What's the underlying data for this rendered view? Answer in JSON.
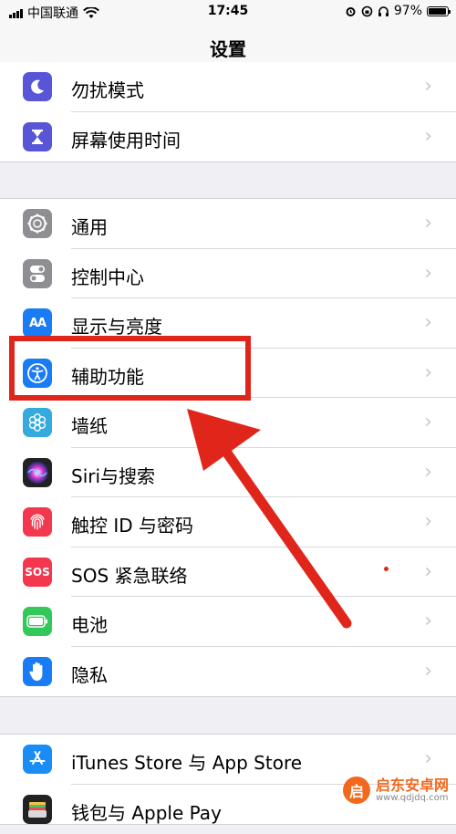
{
  "status_bar": {
    "carrier": "中国联通",
    "time": "17:45",
    "battery_percent": "97%",
    "battery_level": 0.97,
    "icons": [
      "signal-icon",
      "wifi-icon",
      "alarm-icon",
      "headphones-icon",
      "battery-icon"
    ]
  },
  "nav": {
    "title": "设置"
  },
  "group1": [
    {
      "label": "勿扰模式",
      "icon": "moon-icon",
      "color": "#5856d6"
    },
    {
      "label": "屏幕使用时间",
      "icon": "hourglass-icon",
      "color": "#5856d6"
    }
  ],
  "group2": [
    {
      "label": "通用",
      "icon": "gear-icon",
      "color": "#8e8e93"
    },
    {
      "label": "控制中心",
      "icon": "toggles-icon",
      "color": "#8e8e93"
    },
    {
      "label": "显示与亮度",
      "icon": "aa-icon",
      "icon_text": "AA",
      "color": "#1a7cf5"
    },
    {
      "label": "辅助功能",
      "icon": "accessibility-icon",
      "color": "#1a7cf5"
    },
    {
      "label": "墙纸",
      "icon": "flower-icon",
      "color": "#35aadc"
    },
    {
      "label": "Siri与搜索",
      "icon": "siri-icon",
      "color": "#222222"
    },
    {
      "label": "触控 ID 与密码",
      "icon": "fingerprint-icon",
      "color": "#f2374e"
    },
    {
      "label": "SOS 紧急联络",
      "icon": "sos-icon",
      "icon_text": "SOS",
      "color": "#f2374e"
    },
    {
      "label": "电池",
      "icon": "battery-app-icon",
      "color": "#34c759"
    },
    {
      "label": "隐私",
      "icon": "hand-icon",
      "color": "#1a7cf5"
    }
  ],
  "group3": [
    {
      "label": "iTunes Store 与 App Store",
      "icon": "app-store-icon",
      "color": "#1a8cf5"
    },
    {
      "label": "钱包与 Apple Pay",
      "icon": "wallet-icon",
      "color": "#222222"
    }
  ],
  "watermark": {
    "logo": "启",
    "title": "启东安卓网",
    "url": "www.qdjdq.com"
  },
  "accent": "#e0251b"
}
